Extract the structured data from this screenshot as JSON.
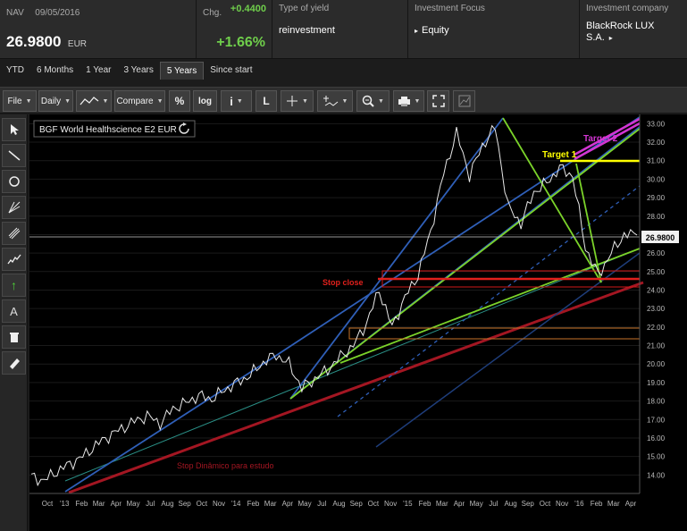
{
  "header": {
    "nav_label": "NAV",
    "nav_date": "09/05/2016",
    "nav_value": "26.9800",
    "nav_currency": "EUR",
    "chg_label": "Chg.",
    "chg_abs": "+0.4400",
    "chg_pct": "+1.66%",
    "yield_label": "Type of yield",
    "yield_value": "reinvestment",
    "focus_label": "Investment Focus",
    "focus_value": "Equity",
    "company_label": "Investment company",
    "company_value_1": "BlackRock LUX",
    "company_value_2": "S.A."
  },
  "tabs": [
    {
      "label": "YTD",
      "active": false
    },
    {
      "label": "6 Months",
      "active": false
    },
    {
      "label": "1 Year",
      "active": false
    },
    {
      "label": "3 Years",
      "active": false
    },
    {
      "label": "5 Years",
      "active": true
    },
    {
      "label": "Since start",
      "active": false
    }
  ],
  "toolbar": {
    "file": "File",
    "daily": "Daily",
    "compare": "Compare",
    "percent": "%",
    "log": "log",
    "info": "i",
    "lin": "L"
  },
  "tools": {
    "text_tool": "A"
  },
  "colors": {
    "green": "#6fce4b",
    "blue_channel": "#2f5fb8",
    "lime": "#7bd32a",
    "red": "#d01818",
    "darkred": "#a31622",
    "yellow": "#ffff00",
    "magenta": "#d335d3",
    "orange": "#c8742a",
    "teal": "#2a8f86"
  },
  "chart_data": {
    "type": "line",
    "title": "BGF World Healthscience E2 EUR",
    "last_value_label": "26.9800",
    "last_value": 26.98,
    "ylim": [
      13.0,
      33.5
    ],
    "y_ticks": [
      14,
      15,
      16,
      17,
      18,
      19,
      20,
      21,
      22,
      23,
      24,
      25,
      26,
      27,
      28,
      29,
      30,
      31,
      32,
      33
    ],
    "x_ticks": [
      "Oct",
      "'13",
      "Feb",
      "Mar",
      "Apr",
      "May",
      "Jul",
      "Aug",
      "Sep",
      "Oct",
      "Nov",
      "'14",
      "Feb",
      "Mar",
      "Apr",
      "May",
      "Jul",
      "Aug",
      "Sep",
      "Oct",
      "Nov",
      "'15",
      "Feb",
      "Mar",
      "Apr",
      "May",
      "Jul",
      "Aug",
      "Sep",
      "Oct",
      "Nov",
      "'16",
      "Feb",
      "Mar",
      "Apr"
    ],
    "x_count": 43,
    "series": [
      {
        "values": [
          13.9,
          13.7,
          14.2,
          14.6,
          15.0,
          15.6,
          16.1,
          16.5,
          16.9,
          17.2,
          16.8,
          17.6,
          17.9,
          18.3,
          18.1,
          18.6,
          19.0,
          19.4,
          20.1,
          20.5,
          20.0,
          18.7,
          19.2,
          19.7,
          20.4,
          21.0,
          22.2,
          24.0,
          22.0,
          23.6,
          24.8,
          27.2,
          30.3,
          32.5,
          30.2,
          31.8,
          32.8,
          28.5,
          27.6,
          29.3,
          29.8,
          30.6,
          30.2,
          26.3,
          24.8,
          26.0,
          27.0,
          26.98
        ]
      }
    ],
    "annotations": [
      {
        "text": "Target 1",
        "color": "#ffff00"
      },
      {
        "text": "Target 2",
        "color": "#d335d3"
      },
      {
        "text": "Stop close",
        "color": "#d01818"
      },
      {
        "text": "Stop Dinâmico para estudo",
        "color": "#a31622"
      }
    ]
  }
}
